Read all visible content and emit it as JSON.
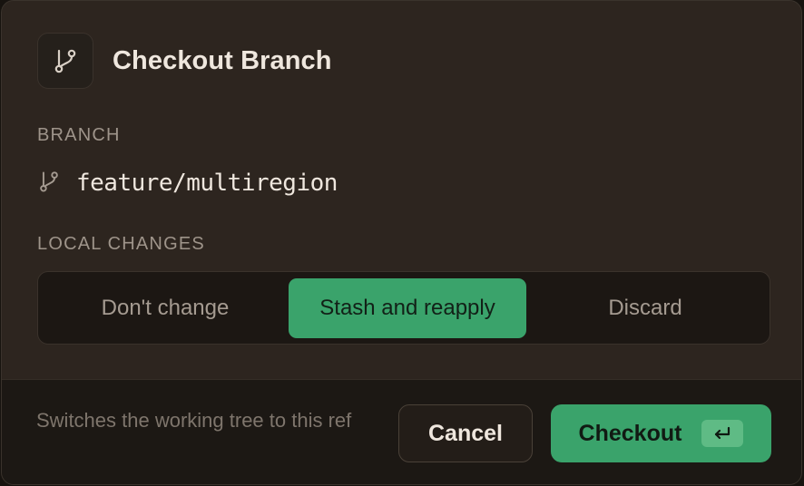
{
  "dialog": {
    "title": "Checkout Branch",
    "title_icon": "git-branch-icon"
  },
  "branch": {
    "label": "BRANCH",
    "icon": "git-branch-icon",
    "name": "feature/multiregion"
  },
  "local_changes": {
    "label": "LOCAL CHANGES",
    "options": [
      {
        "label": "Don't change",
        "selected": false
      },
      {
        "label": "Stash and reapply",
        "selected": true
      },
      {
        "label": "Discard",
        "selected": false
      }
    ]
  },
  "footer": {
    "note": "Switches the working tree to this ref",
    "cancel_label": "Cancel",
    "checkout_label": "Checkout",
    "checkout_shortcut_icon": "enter-key-icon"
  },
  "colors": {
    "accent": "#3aa36b",
    "dialog_bg": "#2d251f",
    "footer_bg": "#1c1814",
    "text": "#efe7de",
    "muted": "#9e948a"
  }
}
